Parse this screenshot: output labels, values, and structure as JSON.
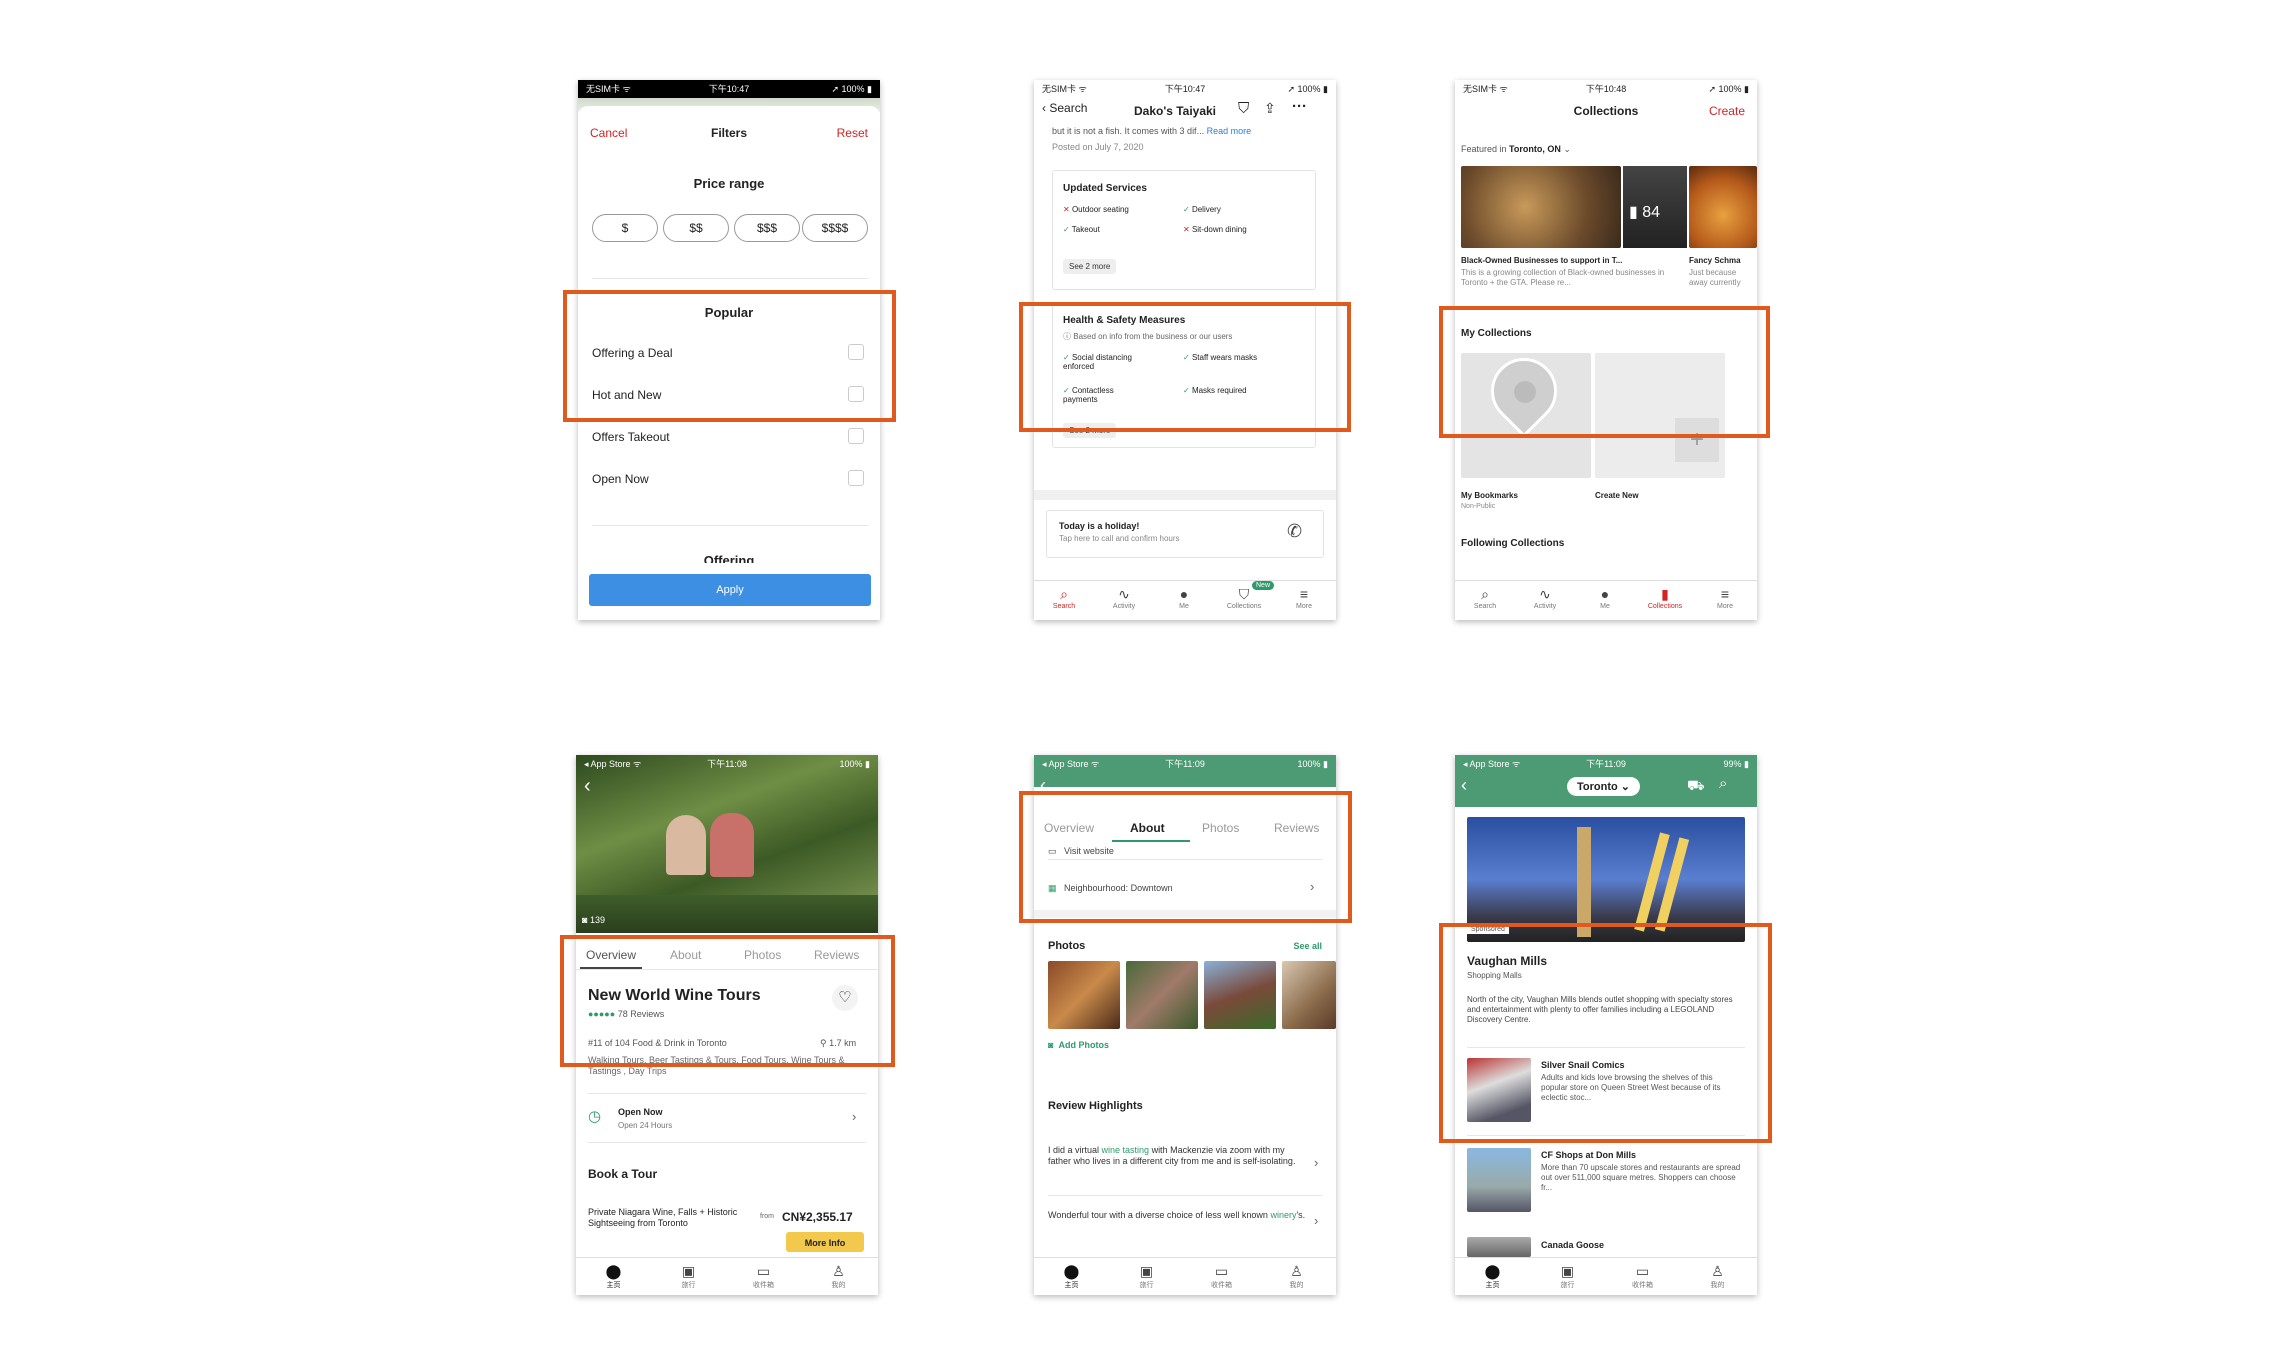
{
  "s1": {
    "status": {
      "left": "无SIM卡 ᯤ",
      "time": "下午10:47",
      "right": "➚ 100% ▮"
    },
    "cancel": "Cancel",
    "title": "Filters",
    "reset": "Reset",
    "price_title": "Price range",
    "prices": [
      "$",
      "$$",
      "$$$",
      "$$$$"
    ],
    "popular_title": "Popular",
    "options": [
      "Offering a Deal",
      "Hot and New",
      "Offers Takeout",
      "Open Now"
    ],
    "next_section": "Offering",
    "apply": "Apply"
  },
  "s2": {
    "status": {
      "left": "无SIM卡 ᯤ",
      "time": "下午10:47",
      "right": "➚ 100% ▮"
    },
    "back": "Search",
    "title": "Dako's Taiyaki",
    "review_snip": "but it is not a fish. It comes with 3 dif...",
    "read_more": "Read more",
    "posted": "Posted on July 7, 2020",
    "services_title": "Updated Services",
    "svc": [
      "Outdoor seating",
      "Delivery",
      "Takeout",
      "Sit-down dining"
    ],
    "see_more1": "See 2 more",
    "health_title": "Health & Safety Measures",
    "health_note": "Based on info from the business or our users",
    "hs": [
      "Social distancing enforced",
      "Staff wears masks",
      "Contactless payments",
      "Masks required"
    ],
    "see_more2": "See 2 more",
    "holiday_title": "Today is a holiday!",
    "holiday_sub": "Tap here to call and confirm hours",
    "tabs": [
      "Search",
      "Activity",
      "Me",
      "Collections",
      "More"
    ],
    "new_badge": "New"
  },
  "s3": {
    "status": {
      "left": "无SIM卡 ᯤ",
      "time": "下午10:48",
      "right": "➚ 100% ▮"
    },
    "title": "Collections",
    "create": "Create",
    "featured_pre": "Featured in",
    "featured_city": "Toronto, ON",
    "bookmark_count": "84",
    "card1_title": "Black-Owned Businesses to support in T...",
    "card1_desc": "This is a growing collection of Black-owned businesses in Toronto + the GTA. Please re...",
    "card2_title": "Fancy Schma",
    "card2_desc": "Just because away currently",
    "my_title": "My Collections",
    "bm_label": "My Bookmarks",
    "bm_sub": "Non-Public",
    "create_new": "Create New",
    "following": "Following Collections",
    "tabs": [
      "Search",
      "Activity",
      "Me",
      "Collections",
      "More"
    ]
  },
  "s4": {
    "status": {
      "left": "◂ App Store ᯤ",
      "time": "下午11:08",
      "right": "100% ▮"
    },
    "photo_count": "139",
    "tabs": [
      "Overview",
      "About",
      "Photos",
      "Reviews"
    ],
    "name": "New World Wine Tours",
    "reviews": "78 Reviews",
    "rank": "#11 of 104 Food & Drink in Toronto",
    "distance": "1.7 km",
    "categories": "Walking Tours, Beer Tastings & Tours, Food Tours, Wine Tours & Tastings , Day Trips",
    "open": "Open Now",
    "open_sub": "Open 24 Hours",
    "book_title": "Book a Tour",
    "tour_name": "Private Niagara Wine, Falls + Historic Sightseeing from Toronto",
    "from": "from",
    "price": "CN¥2,355.17",
    "more_info": "More Info",
    "bottom": [
      "主页",
      "旅行",
      "收件箱",
      "我的"
    ]
  },
  "s5": {
    "status": {
      "left": "◂ App Store ᯤ",
      "time": "下午11:09",
      "right": "100% ▮"
    },
    "tabs": [
      "Overview",
      "About",
      "Photos",
      "Reviews"
    ],
    "visit": "Visit website",
    "neigh": "Neighbourhood: Downtown",
    "photos_title": "Photos",
    "see_all": "See all",
    "add_photos": "Add Photos",
    "rh_title": "Review Highlights",
    "r1_pre": "I did a virtual ",
    "r1_link": "wine tasting",
    "r1_post": " with Mackenzie via zoom with my father who lives in a different city from me and is self-isolating.",
    "r2_pre": "Wonderful tour with a diverse choice of less well known ",
    "r2_link": "winery",
    "r2_post": "'s.",
    "bottom": [
      "主页",
      "旅行",
      "收件箱",
      "我的"
    ]
  },
  "s6": {
    "status": {
      "left": "◂ App Store ᯤ",
      "time": "下午11:09",
      "right": "99% ▮"
    },
    "city": "Toronto",
    "sponsored": "Sponsored",
    "vm_title": "Vaughan Mills",
    "vm_sub": "Shopping Malls",
    "vm_desc": "North of the city, Vaughan Mills blends outlet shopping with specialty stores and entertainment with plenty to offer families including a LEGOLAND Discovery Centre.",
    "items": [
      {
        "title": "Silver Snail Comics",
        "desc": "Adults and kids love browsing the shelves of this popular store on Queen Street West because of its eclectic stoc..."
      },
      {
        "title": "CF Shops at Don Mills",
        "desc": "More than 70 upscale stores and restaurants are spread out over 511,000 square metres. Shoppers can choose fr..."
      },
      {
        "title": "Canada Goose",
        "desc": ""
      }
    ],
    "bottom": [
      "主页",
      "旅行",
      "收件箱",
      "我的"
    ]
  }
}
